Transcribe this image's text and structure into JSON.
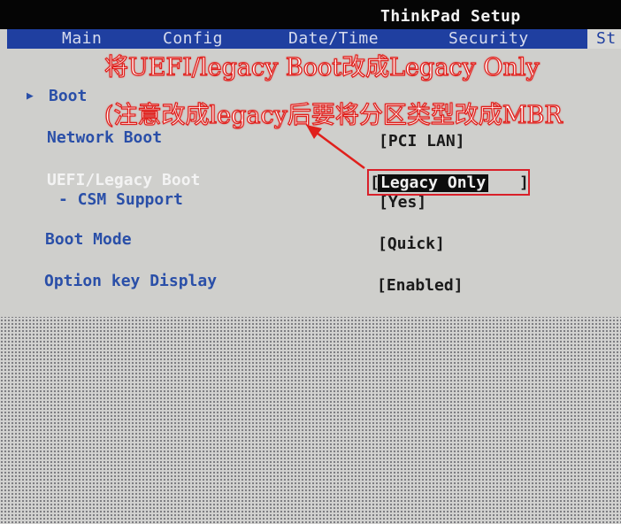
{
  "window": {
    "title": "ThinkPad Setup"
  },
  "tabs": [
    {
      "label": "Main"
    },
    {
      "label": "Config"
    },
    {
      "label": "Date/Time"
    },
    {
      "label": "Security"
    },
    {
      "label": "St"
    }
  ],
  "menu": {
    "boot": "Boot",
    "items": [
      {
        "label": "Network Boot",
        "value": "[PCI LAN]"
      },
      {
        "label": "UEFI/Legacy Boot",
        "value": "Legacy Only"
      },
      {
        "label": "- CSM Support",
        "value": "[Yes]"
      },
      {
        "label": "Boot Mode",
        "value": "[Quick]"
      },
      {
        "label": "Option key Display",
        "value": "[Enabled]"
      }
    ]
  },
  "annotations": {
    "line1": "将UEFI/legacy Boot改成Legacy Only",
    "line2": "(注意改成legacy后要将分区类型改成MBR"
  },
  "colors": {
    "tab_bar": "#1f3fa0",
    "label_blue": "#2a4fa8",
    "annotation_red": "#e0201c",
    "highlight_box": "#d9202a"
  },
  "icons": {
    "boot_arrow": "triangle-right-icon"
  }
}
